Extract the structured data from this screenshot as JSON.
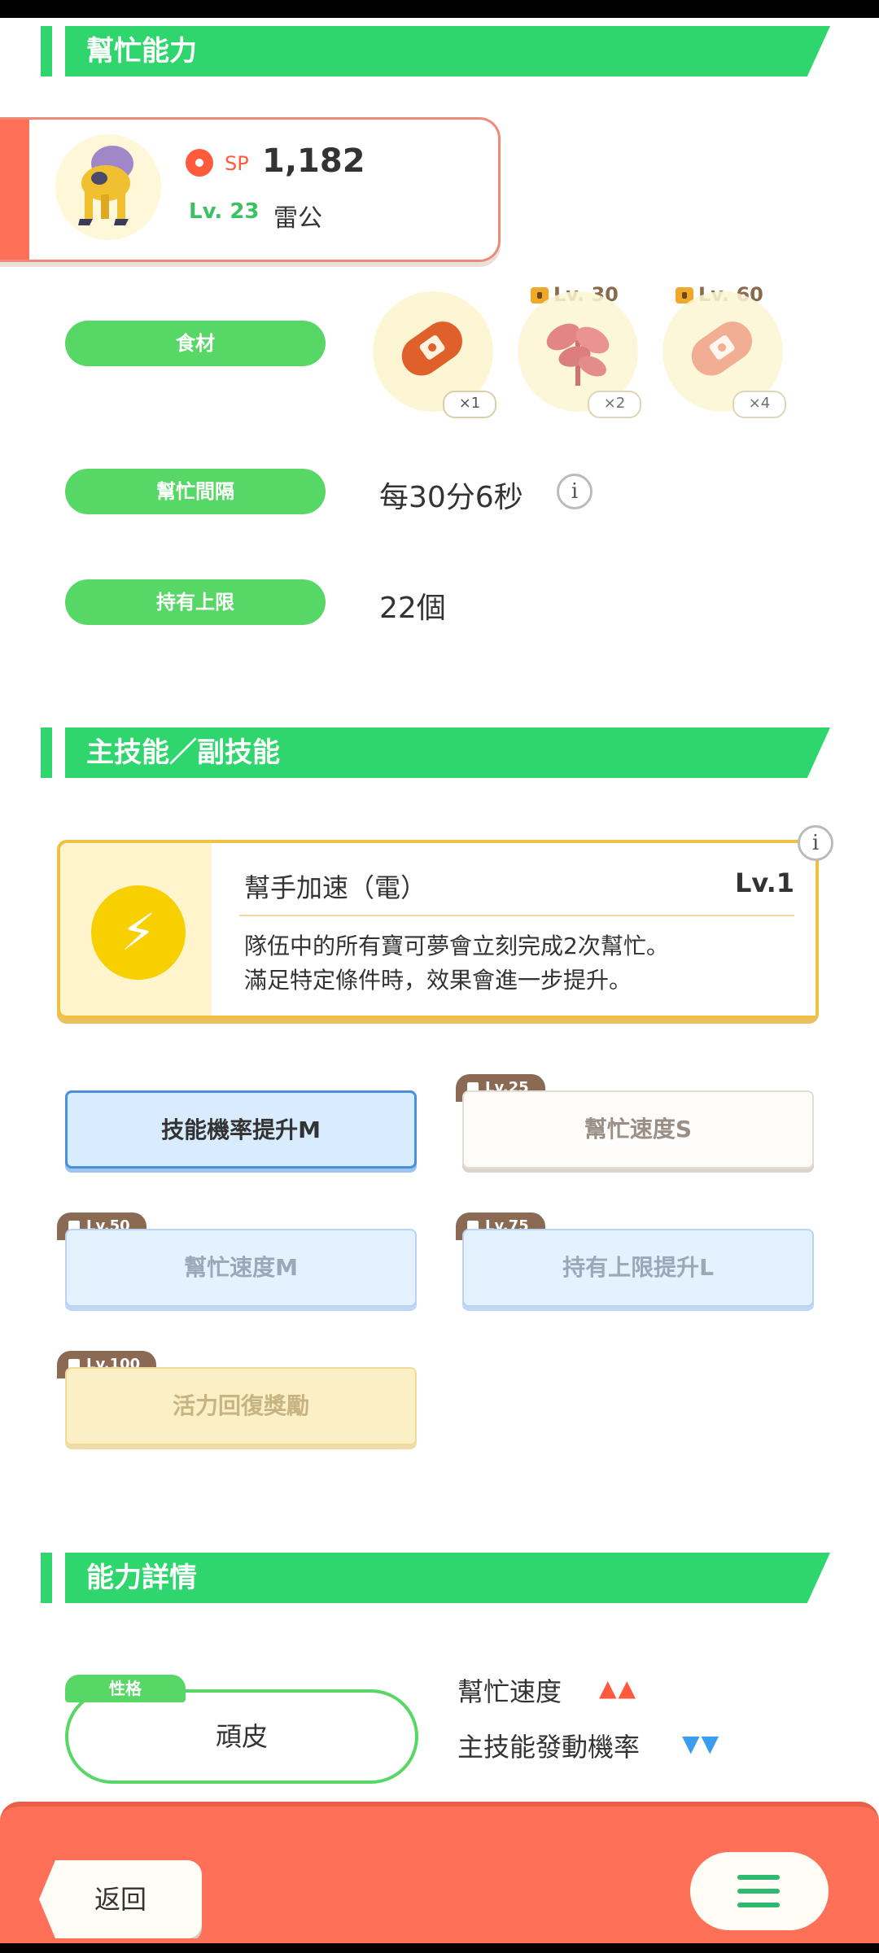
{
  "sections": {
    "help_ability": "幫忙能力",
    "main_sub_skill": "主技能／副技能",
    "ability_details": "能力詳情"
  },
  "pokemon": {
    "sp_label": "SP",
    "sp_value": "1,182",
    "level": "Lv. 23",
    "name": "雷公"
  },
  "ingredients": {
    "label": "食材",
    "items": [
      {
        "mult": "×1",
        "unlock": ""
      },
      {
        "mult": "×2",
        "unlock": "Lv. 30"
      },
      {
        "mult": "×4",
        "unlock": "Lv. 60"
      }
    ]
  },
  "help_interval": {
    "label": "幫忙間隔",
    "value": "每30分6秒"
  },
  "carry_limit": {
    "label": "持有上限",
    "value": "22個"
  },
  "main_skill": {
    "name": "幫手加速（電）",
    "level": "Lv.1",
    "desc_line1": "隊伍中的所有寶可夢會立刻完成2次幫忙。",
    "desc_line2": "滿足特定條件時，效果會進一步提升。"
  },
  "sub_skills": [
    {
      "name": "技能機率提升M",
      "unlock": ""
    },
    {
      "name": "幫忙速度S",
      "unlock": "Lv.25"
    },
    {
      "name": "幫忙速度M",
      "unlock": "Lv.50"
    },
    {
      "name": "持有上限提升L",
      "unlock": "Lv.75"
    },
    {
      "name": "活力回復獎勵",
      "unlock": "Lv.100"
    }
  ],
  "nature": {
    "tag": "性格",
    "value": "頑皮",
    "up_label": "幫忙速度",
    "up_arrows": "▲▲",
    "down_label": "主技能發動機率",
    "down_arrows": "▼▼"
  },
  "bottom_bar": {
    "back": "返回"
  },
  "colors": {
    "green": "#2fd66d",
    "pill_green": "#57d765",
    "coral": "#ff7058",
    "skill_gold": "#f0c040"
  }
}
